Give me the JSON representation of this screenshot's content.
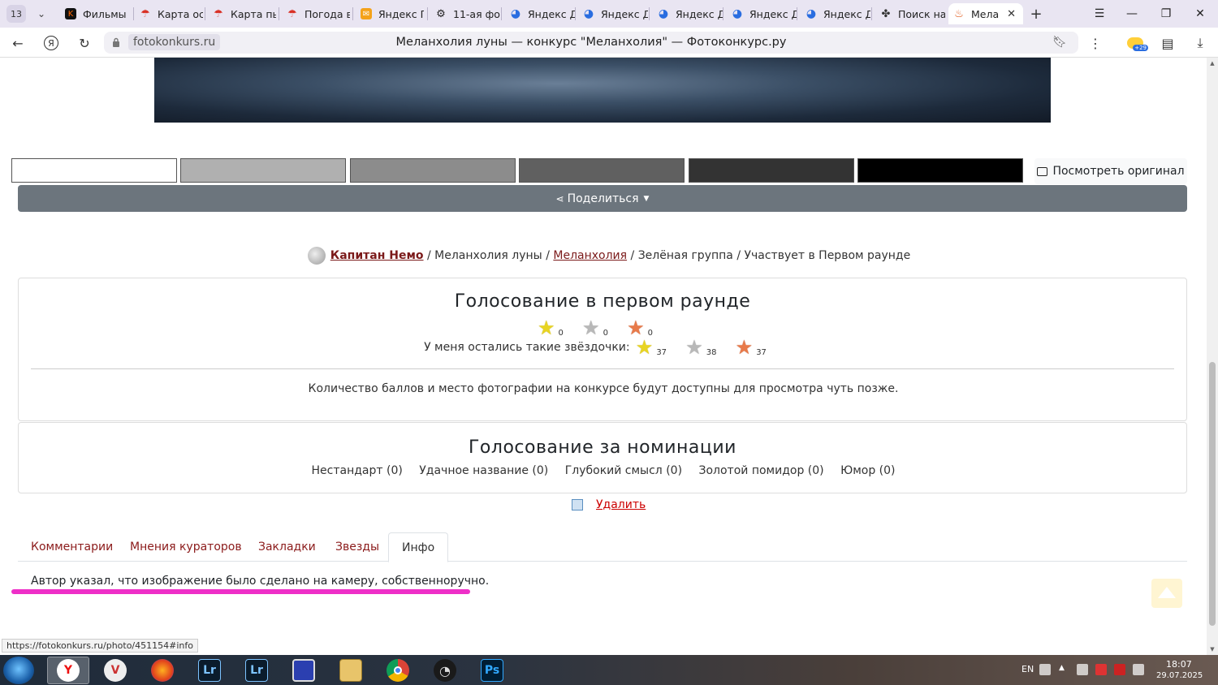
{
  "browser": {
    "tab_count": "13",
    "tabs": [
      {
        "label": "Фильмы",
        "icon": "kinopoisk-icon",
        "color": "#111111"
      },
      {
        "label": "Карта ос",
        "icon": "umbrella-icon",
        "color": "#d93025"
      },
      {
        "label": "Карта пь",
        "icon": "umbrella-icon",
        "color": "#d93025"
      },
      {
        "label": "Погода в",
        "icon": "umbrella-icon",
        "color": "#d93025"
      },
      {
        "label": "Яндекс П",
        "icon": "mail-icon",
        "color": "#f4a21a"
      },
      {
        "label": "11-ая фо",
        "icon": "camera-icon",
        "color": "#222222"
      },
      {
        "label": "Яндекс Д",
        "icon": "yandex-disk-icon",
        "color": "#2a6de0"
      },
      {
        "label": "Яндекс Д",
        "icon": "yandex-disk-icon",
        "color": "#2a6de0"
      },
      {
        "label": "Яндекс Д",
        "icon": "yandex-disk-icon",
        "color": "#2a6de0"
      },
      {
        "label": "Яндекс Д",
        "icon": "yandex-disk-icon",
        "color": "#2a6de0"
      },
      {
        "label": "Яндекс Д",
        "icon": "yandex-disk-icon",
        "color": "#2a6de0"
      },
      {
        "label": "Поиск на",
        "icon": "puzzle-icon",
        "color": "#333333"
      },
      {
        "label": "Мела",
        "icon": "fotokonkurs-icon",
        "color": "#e05a1a"
      }
    ],
    "url_domain": "fotokonkurs.ru",
    "page_title": "Меланхолия луны — конкурс \"Меланхолия\" — Фотоконкурс.ру",
    "status_url": "https://fotokonkurs.ru/photo/451154#info"
  },
  "page": {
    "swatches": [
      "#ffffff",
      "#b0b0b0",
      "#8c8c8c",
      "#606060",
      "#333333",
      "#000000"
    ],
    "view_original_label": "Посмотреть оригинал",
    "share_label": "Поделиться",
    "breadcrumb": {
      "author": "Капитан Немо",
      "sep1": " / ",
      "photo_title": "Меланхолия луны",
      "sep2": " / ",
      "contest": "Меланхолия",
      "rest": " / Зелёная группа / Участвует в Первом раунде"
    },
    "voting": {
      "title": "Голосование в первом раунде",
      "given": {
        "gold": "0",
        "silver": "0",
        "bronze": "0"
      },
      "remaining_label": "У меня остались такие звёздочки:",
      "remaining": {
        "gold": "37",
        "silver": "38",
        "bronze": "37"
      },
      "note": "Количество баллов и место фотографии на конкурсе будут доступны для просмотра чуть позже."
    },
    "nominations": {
      "title": "Голосование за номинации",
      "items": [
        "Нестандарт (0)",
        "Удачное название (0)",
        "Глубокий смысл (0)",
        "Золотой помидор (0)",
        "Юмор (0)"
      ]
    },
    "delete_label": "Удалить",
    "tabs": [
      "Комментарии",
      "Мнения кураторов",
      "Закладки",
      "Звезды",
      "Инфо"
    ],
    "active_tab": "Инфо",
    "info_text": "Автор указал, что изображение было сделано на камеру, собственноручно."
  },
  "taskbar": {
    "apps": [
      "yandex-browser-icon",
      "vivaldi-icon",
      "firefox-icon",
      "lightroom-icon",
      "lightroom-icon",
      "save-icon",
      "file-manager-icon",
      "chrome-icon",
      "speedometer-icon",
      "photoshop-icon"
    ],
    "lang": "EN",
    "time": "18:07",
    "date": "29.07.2025"
  }
}
